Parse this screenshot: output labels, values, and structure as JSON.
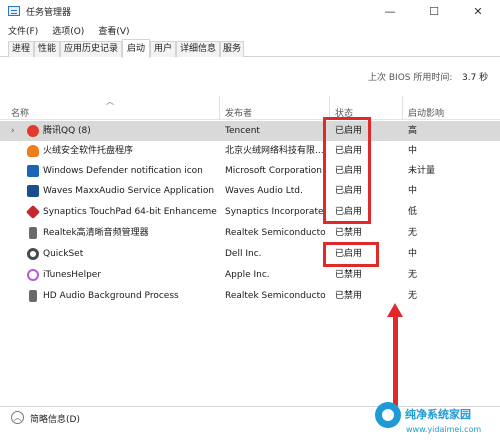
{
  "window": {
    "title": "任务管理器",
    "controls": {
      "minimize": "—",
      "maximize": "☐",
      "close": "✕"
    }
  },
  "menu": {
    "items": [
      "文件(F)",
      "选项(O)",
      "查看(V)"
    ]
  },
  "tabs": [
    "进程",
    "性能",
    "应用历史记录",
    "启动",
    "用户",
    "详细信息",
    "服务"
  ],
  "active_tab": "启动",
  "bios": {
    "label": "上次 BIOS 所用时间:",
    "value": "3.7 秒"
  },
  "columns": {
    "name": "名称",
    "publisher": "发布者",
    "status": "状态",
    "impact": "启动影响"
  },
  "rows": [
    {
      "name": "腾讯QQ (8)",
      "publisher": "Tencent",
      "status": "已启用",
      "impact": "高",
      "icon": "penguin-icon",
      "color": "#e23a2e",
      "expandable": true,
      "selected": true
    },
    {
      "name": "火绒安全软件托盘程序",
      "publisher": "北京火绒网络科技有限...",
      "status": "已启用",
      "impact": "中",
      "icon": "shield-icon",
      "color": "#f07c1a",
      "expandable": false,
      "selected": false
    },
    {
      "name": "Windows Defender notification icon",
      "publisher": "Microsoft Corporation",
      "status": "已启用",
      "impact": "未计量",
      "icon": "defender-icon",
      "color": "#1c64b8",
      "expandable": false,
      "selected": false
    },
    {
      "name": "Waves MaxxAudio Service Application",
      "publisher": "Waves Audio Ltd.",
      "status": "已启用",
      "impact": "中",
      "icon": "waves-icon",
      "color": "#1b4f8c",
      "expandable": false,
      "selected": false
    },
    {
      "name": "Synaptics TouchPad 64-bit Enhanceme...",
      "publisher": "Synaptics Incorporated",
      "status": "已启用",
      "impact": "低",
      "icon": "touchpad-icon",
      "color": "#c8262f",
      "expandable": false,
      "selected": false
    },
    {
      "name": "Realtek高清晰音频管理器",
      "publisher": "Realtek Semiconductor",
      "status": "已禁用",
      "impact": "无",
      "icon": "speaker-icon",
      "color": "#6a6a6a",
      "expandable": false,
      "selected": false
    },
    {
      "name": "QuickSet",
      "publisher": "Dell Inc.",
      "status": "已启用",
      "impact": "中",
      "icon": "gear-icon",
      "color": "#4a4a4a",
      "expandable": false,
      "selected": false
    },
    {
      "name": "iTunesHelper",
      "publisher": "Apple Inc.",
      "status": "已禁用",
      "impact": "无",
      "icon": "itunes-icon",
      "color": "#b55bd8",
      "expandable": false,
      "selected": false
    },
    {
      "name": "HD Audio Background Process",
      "publisher": "Realtek Semiconductor",
      "status": "已禁用",
      "impact": "无",
      "icon": "speaker-icon",
      "color": "#6a6a6a",
      "expandable": false,
      "selected": false
    }
  ],
  "footer": {
    "fewer_details": "简略信息(D)"
  },
  "watermark": {
    "title": "纯净系统家园",
    "url": "www.yidaimei.com"
  },
  "colors": {
    "highlight": "#e02a2a",
    "selected_row": "#d9d9d9"
  }
}
